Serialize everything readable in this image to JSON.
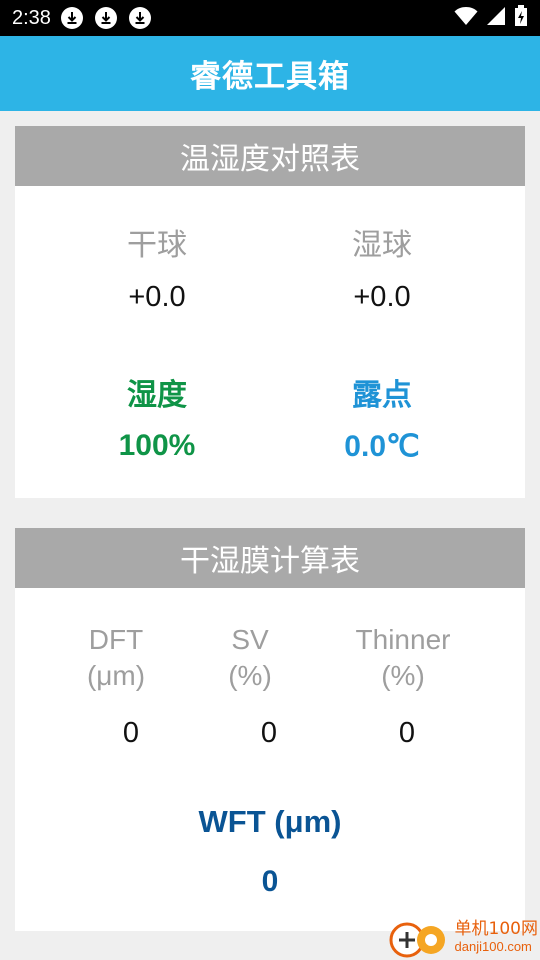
{
  "status_bar": {
    "time": "2:38",
    "icons": [
      "download-icon",
      "download-icon",
      "download-icon",
      "wifi-icon",
      "signal-icon",
      "battery-icon"
    ]
  },
  "app_bar": {
    "title": "睿德工具箱",
    "color": "#2db4e6"
  },
  "humidity_card": {
    "title": "温湿度对照表",
    "dry_bulb": {
      "label": "干球",
      "value": "+0.0"
    },
    "wet_bulb": {
      "label": "湿球",
      "value": "+0.0"
    },
    "humidity": {
      "label": "湿度",
      "value": "100%",
      "color": "#0f9447"
    },
    "dew_point": {
      "label": "露点",
      "value": "0.0℃",
      "color": "#1f93d6"
    }
  },
  "film_card": {
    "title": "干湿膜计算表",
    "dft": {
      "label_line1": "DFT",
      "label_line2": "(μm)",
      "value": "0"
    },
    "sv": {
      "label_line1": "SV",
      "label_line2": "(%)",
      "value": "0"
    },
    "thinner": {
      "label_line1": "Thinner",
      "label_line2": "(%)",
      "value": "0"
    },
    "wft": {
      "label": "WFT (μm)",
      "value": "0",
      "color": "#0a5494"
    }
  },
  "watermark": {
    "cn": "单机100网",
    "en": "danji100.com"
  }
}
